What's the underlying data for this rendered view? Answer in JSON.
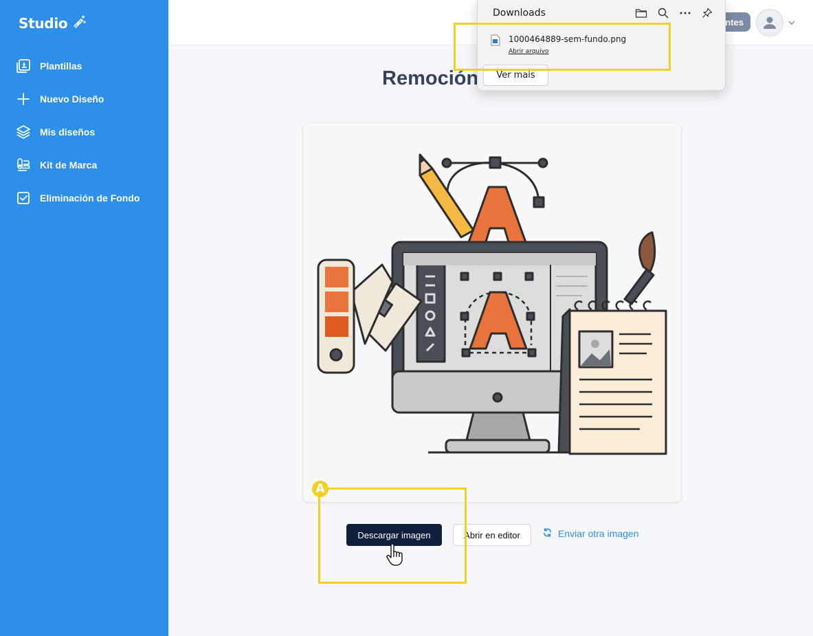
{
  "app": {
    "name": "Studio"
  },
  "sidebar": {
    "items": [
      {
        "label": "Plantillas",
        "icon": "templates-icon"
      },
      {
        "label": "Nuevo Diseño",
        "icon": "plus-icon"
      },
      {
        "label": "Mis diseños",
        "icon": "layers-icon"
      },
      {
        "label": "Kit de Marca",
        "icon": "brand-kit-icon"
      },
      {
        "label": "Eliminación de Fondo",
        "icon": "checkbox-icon"
      }
    ]
  },
  "header": {
    "pill_label": "ntes"
  },
  "main": {
    "title": "Remoción",
    "actions": {
      "download": "Descargar imagen",
      "open_editor": "Abrir en editor",
      "send_other": "Enviar otra imagen"
    }
  },
  "annotation": {
    "badge": "A"
  },
  "downloads": {
    "title": "Downloads",
    "file_name": "1000464889-sem-fundo.png",
    "open_file": "Abrir arquivo",
    "see_more": "Ver mais"
  },
  "colors": {
    "sidebar": "#2e8fe8",
    "primary_button": "#0f1f3c",
    "link": "#2e8fe8",
    "annotation": "#f2d125"
  }
}
